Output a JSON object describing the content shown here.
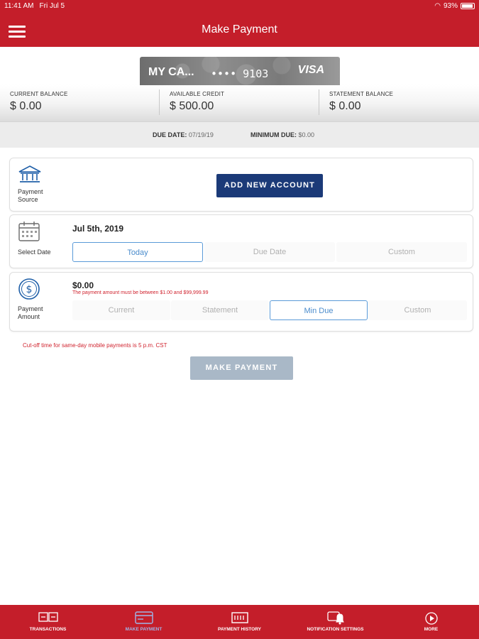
{
  "status_bar": {
    "time": "11:41 AM",
    "date": "Fri Jul 5",
    "battery": "93%"
  },
  "header": {
    "title": "Make Payment"
  },
  "card": {
    "name": "MY CA...",
    "number": "•••• 9103",
    "brand": "VISA"
  },
  "balances": [
    {
      "label": "CURRENT BALANCE",
      "value": "$ 0.00"
    },
    {
      "label": "AVAILABLE CREDIT",
      "value": "$ 500.00"
    },
    {
      "label": "STATEMENT BALANCE",
      "value": "$ 0.00"
    }
  ],
  "due": {
    "due_date_label": "DUE DATE:",
    "due_date_value": "07/19/19",
    "minimum_due_label": "MINIMUM DUE:",
    "minimum_due_value": "$0.00"
  },
  "payment_source": {
    "label_line1": "Payment",
    "label_line2": "Source",
    "button": "ADD NEW ACCOUNT"
  },
  "select_date": {
    "label": "Select Date",
    "value": "Jul 5th, 2019",
    "options": [
      "Today",
      "Due Date",
      "Custom"
    ],
    "selected": "Today"
  },
  "payment_amount": {
    "label_line1": "Payment",
    "label_line2": "Amount",
    "value": "$0.00",
    "hint": "The payment amount must be between $1.00 and $99,999.99",
    "options": [
      "Current",
      "Statement",
      "Min Due",
      "Custom"
    ],
    "selected": "Min Due"
  },
  "cutoff_note": "Cut-off time for same-day mobile payments is 5 p.m. CST",
  "make_payment_button": "MAKE PAYMENT",
  "bottom_nav": {
    "items": [
      {
        "label": "TRANSACTIONS",
        "icon": "transactions-icon"
      },
      {
        "label": "MAKE PAYMENT",
        "icon": "make-payment-icon"
      },
      {
        "label": "PAYMENT HISTORY",
        "icon": "payment-history-icon"
      },
      {
        "label": "NOTIFICATION SETTINGS",
        "icon": "notification-settings-icon"
      },
      {
        "label": "MORE",
        "icon": "more-icon"
      }
    ],
    "active": "MAKE PAYMENT"
  },
  "colors": {
    "brand_red": "#c41e2a",
    "navy_button": "#1b3a78",
    "accent_blue": "#4b8ccc",
    "disabled_button": "#a9b8c7",
    "error_red": "#d0232e"
  }
}
